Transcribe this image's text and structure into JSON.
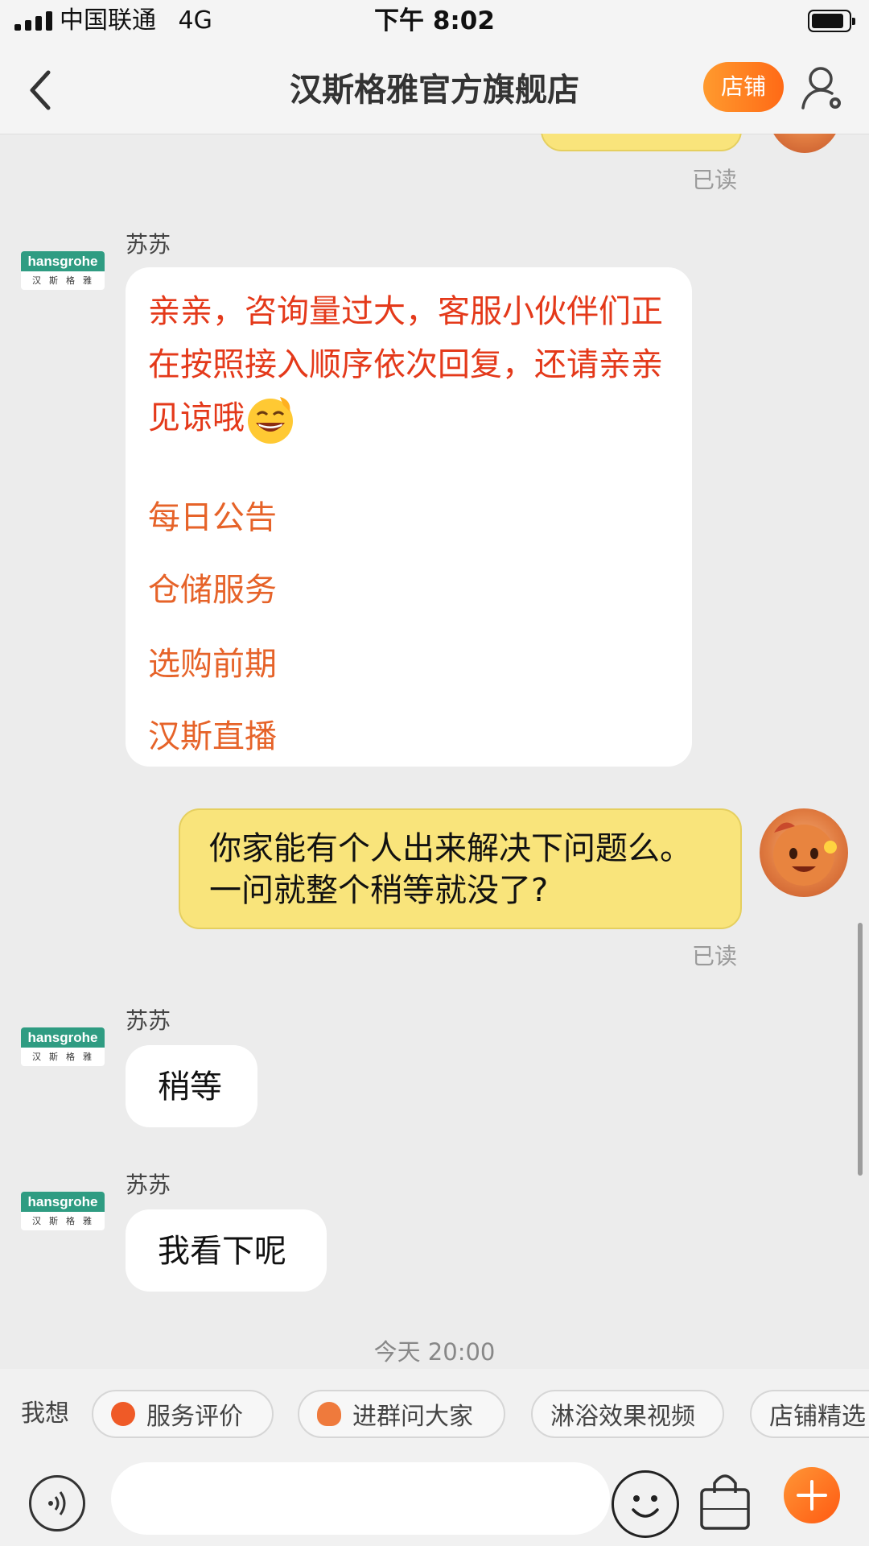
{
  "status_bar": {
    "carrier": "中国联通",
    "network": "4G",
    "time": "下午 8:02"
  },
  "nav": {
    "title": "汉斯格雅官方旗舰店",
    "shop_label": "店铺"
  },
  "brand_logo": {
    "text": "hansgrohe",
    "subtext": "汉斯格雅"
  },
  "messages": [
    {
      "type": "read_receipt",
      "text": "已读"
    },
    {
      "type": "incoming",
      "sender": "苏苏",
      "text": "亲亲，咨询量过大，客服小伙伴们正在按照接入顺序依次回复，还请亲亲见谅哦",
      "menu": [
        "每日公告",
        "仓储服务",
        "选购前期",
        "汉斯直播"
      ]
    },
    {
      "type": "outgoing",
      "text": "你家能有个人出来解决下问题么。一问就整个稍等就没了?",
      "status": "已读"
    },
    {
      "type": "incoming",
      "sender": "苏苏",
      "text": "稍等"
    },
    {
      "type": "incoming",
      "sender": "苏苏",
      "text": "我看下呢"
    },
    {
      "type": "timestamp",
      "text": "今天 20:00"
    }
  ],
  "quick_replies": {
    "label": "我想",
    "items": [
      "服务评价",
      "进群问大家",
      "淋浴效果视频",
      "店铺精选"
    ]
  },
  "input": {
    "placeholder": ""
  },
  "colors": {
    "accent_orange": "#ff6a16",
    "bubble_yellow": "#f9e47b",
    "auto_reply_red": "#e4391a",
    "link_orange": "#e66329",
    "brand_green": "#2f9c82"
  },
  "icons": [
    "back-icon",
    "profile-settings-icon",
    "voice-icon",
    "emoji-icon",
    "shopping-bag-icon",
    "plus-icon",
    "rating-icon",
    "group-icon"
  ]
}
